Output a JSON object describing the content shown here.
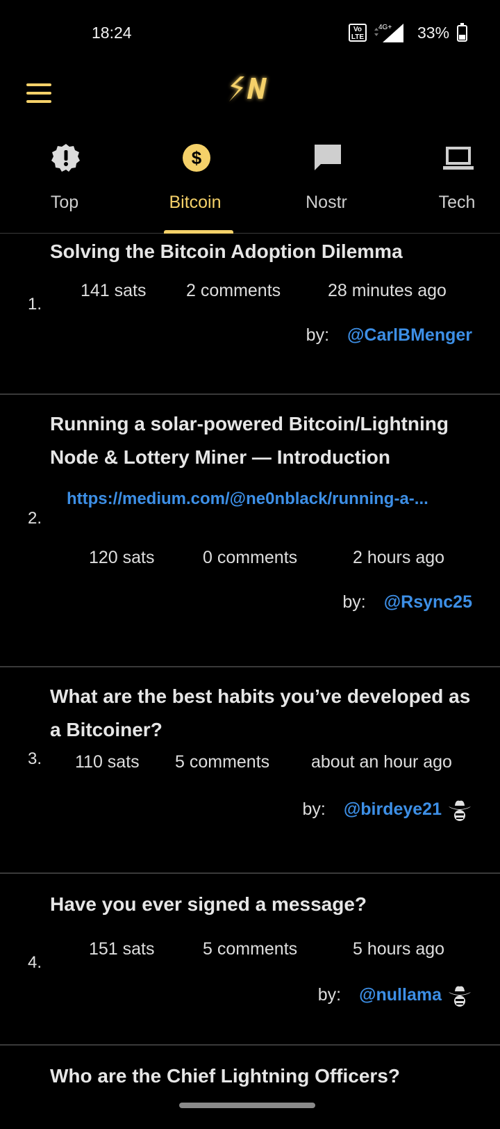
{
  "status": {
    "time": "18:24",
    "volte": "Vo\nLTE",
    "network": "4G+",
    "battery": "33%",
    "battery_level": 0.33
  },
  "app": {
    "logo_text": "SN",
    "accent": "#f5d169",
    "link_color": "#3d8fe6"
  },
  "tabs": [
    {
      "label": "Top",
      "icon": "alert-badge-icon"
    },
    {
      "label": "Bitcoin",
      "icon": "dollar-coin-icon",
      "active": true
    },
    {
      "label": "Nostr",
      "icon": "chat-bubble-icon"
    },
    {
      "label": "Tech",
      "icon": "laptop-icon"
    }
  ],
  "items": [
    {
      "rank": "1.",
      "title": "Solving the Bitcoin Adoption Dilemma",
      "sats": "141 sats",
      "comments": "2 comments",
      "time": "28 minutes ago",
      "by": "by:",
      "user": "@CarlBMenger"
    },
    {
      "rank": "2.",
      "title": "Running a solar-powered Bitcoin/Lightning Node & Lottery Miner — Introduction",
      "link": "https://medium.com/@ne0nblack/running-a-...",
      "sats": "120 sats",
      "comments": "0 comments",
      "time": "2 hours ago",
      "by": "by:",
      "user": "@Rsync25"
    },
    {
      "rank": "3.",
      "title": "What are the best habits you’ve developed as a Bitcoiner?",
      "sats": "110 sats",
      "comments": "5 comments",
      "time": "about an hour ago",
      "by": "by:",
      "user": "@birdeye21",
      "hat": "cowboy-hat-icon"
    },
    {
      "rank": "4.",
      "title": "Have you ever signed a message?",
      "sats": "151 sats",
      "comments": "5 comments",
      "time": "5 hours ago",
      "by": "by:",
      "user": "@nullama",
      "hat": "cowboy-hat-icon"
    },
    {
      "title": "Who are the Chief Lightning Officers?"
    }
  ]
}
